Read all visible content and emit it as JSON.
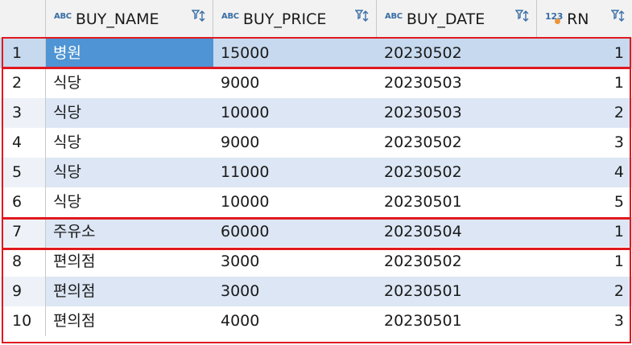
{
  "columns": [
    {
      "type_tag": "ABC",
      "name": "BUY_NAME"
    },
    {
      "type_tag": "ABC",
      "name": "BUY_PRICE"
    },
    {
      "type_tag": "ABC",
      "name": "BUY_DATE"
    },
    {
      "type_tag": "123",
      "name": "RN"
    }
  ],
  "rows": [
    {
      "idx": "1",
      "buy_name": "병원",
      "buy_price": "15000",
      "buy_date": "20230502",
      "rn": "1"
    },
    {
      "idx": "2",
      "buy_name": "식당",
      "buy_price": "9000",
      "buy_date": "20230503",
      "rn": "1"
    },
    {
      "idx": "3",
      "buy_name": "식당",
      "buy_price": "10000",
      "buy_date": "20230503",
      "rn": "2"
    },
    {
      "idx": "4",
      "buy_name": "식당",
      "buy_price": "9000",
      "buy_date": "20230502",
      "rn": "3"
    },
    {
      "idx": "5",
      "buy_name": "식당",
      "buy_price": "11000",
      "buy_date": "20230502",
      "rn": "4"
    },
    {
      "idx": "6",
      "buy_name": "식당",
      "buy_price": "10000",
      "buy_date": "20230501",
      "rn": "5"
    },
    {
      "idx": "7",
      "buy_name": "주유소",
      "buy_price": "60000",
      "buy_date": "20230504",
      "rn": "1"
    },
    {
      "idx": "8",
      "buy_name": "편의점",
      "buy_price": "3000",
      "buy_date": "20230502",
      "rn": "1"
    },
    {
      "idx": "9",
      "buy_name": "편의점",
      "buy_price": "3000",
      "buy_date": "20230501",
      "rn": "2"
    },
    {
      "idx": "10",
      "buy_name": "편의점",
      "buy_price": "4000",
      "buy_date": "20230501",
      "rn": "3"
    }
  ],
  "selected_row": "1",
  "colors": {
    "header_bg": "#f2f2f2",
    "alt_row_bg": "#dce6f4",
    "selected_cell_bg": "#4f94d4",
    "highlight_border": "#e0191f",
    "type_icon": "#3a6ea5"
  },
  "icons": {
    "column_type": "abc-type-icon",
    "numeric_type": "number-type-icon",
    "filter_sort": "filter-sort-icon"
  }
}
